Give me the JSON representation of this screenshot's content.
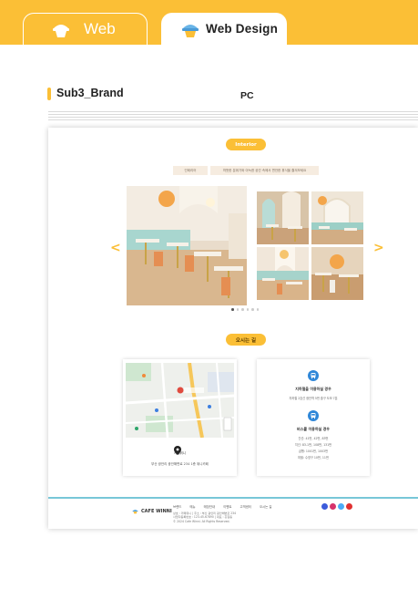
{
  "tabs": [
    {
      "label": "Web",
      "active": false
    },
    {
      "label": "Web Design",
      "active": true
    }
  ],
  "icons": {
    "tab_web": "cup-icon",
    "tab_design": "cup-icon"
  },
  "colors": {
    "accent": "#fbbf36",
    "footer_line": "#78c7d8",
    "bus_icon": "#2f87d8"
  },
  "section": {
    "title": "Sub3_Brand",
    "device": "PC"
  },
  "mockup": {
    "interior_button": "Interior",
    "info_tabs": [
      "인테리어",
      "따뜻한 분위기와 아늑한 공간 속에서 편안한 휴식을 즐겨보세요"
    ],
    "carousel": {
      "prev": "<",
      "next": ">",
      "slide_count": 6,
      "active_slide": 1
    },
    "location_button": "오시는 길",
    "map": {
      "place": "카페위니",
      "address": "부산 광안리 광안해변로 234 1층 위니카페"
    },
    "bus": {
      "heading1": "지하철을 이용하실 경우",
      "line1": "지하철 2호선 광안역 5번 출구 도보 7분",
      "heading2": "버스를 이용하실 경우",
      "lines2": [
        "간선: 41번, 42번, 83번",
        "지선: 83-1번, 108번, 131번",
        "급행: 1001번, 1003번",
        "마을: 수영구 10번, 11번"
      ]
    },
    "footer": {
      "logo": "CAFE WINNI",
      "nav": [
        "브랜드",
        "메뉴",
        "매장안내",
        "이벤트",
        "고객센터",
        "오시는 길"
      ],
      "info": [
        "상호 : 카페위니 | 주소 : 부산 광안리 광안해변로 234",
        "사업자등록번호 : 123-45-67890 | 대표 : 홍길동",
        "© 2024 Cafe Winni. All Rights Reserved."
      ],
      "socials": [
        "facebook-icon",
        "instagram-icon",
        "twitter-icon",
        "youtube-icon"
      ]
    }
  }
}
